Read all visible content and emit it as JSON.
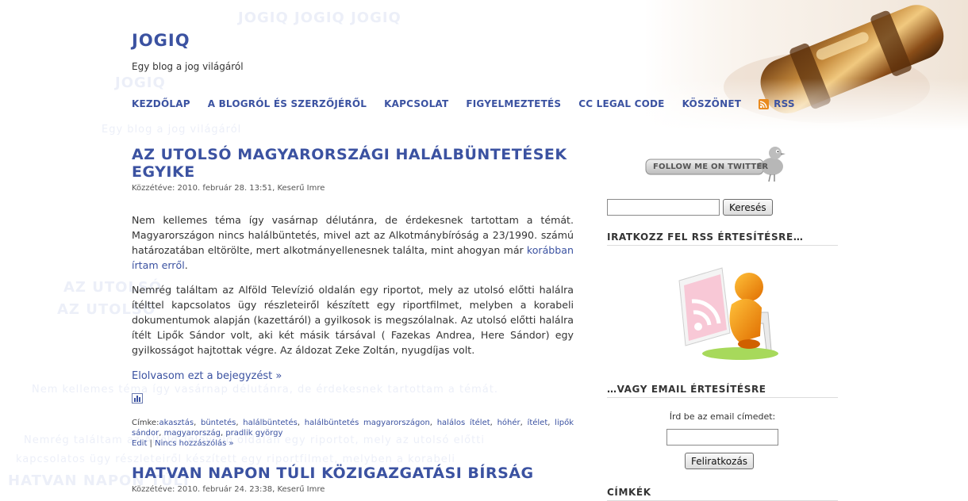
{
  "site": {
    "title": "JOGIQ",
    "tagline": "Egy blog a jog világáról"
  },
  "nav": {
    "items": [
      "KEZDŐLAP",
      "A BLOGRÓL ÉS SZERZŐJÉRŐL",
      "KAPCSOLAT",
      "FIGYELMEZTETÉS",
      "CC LEGAL CODE",
      "KÖSZÖNET"
    ],
    "rss_label": "RSS"
  },
  "posts": [
    {
      "title": "AZ UTOLSÓ MAGYARORSZÁGI HALÁLBÜNTETÉSEK EGYIKE",
      "meta": "Közzétéve: 2010. február 28. 13:51, Keserű Imre",
      "p1_text": "Nem kellemes téma így vasárnap délutánra, de érdekesnek tartottam a témát. Magyarországon nincs halálbüntetés, mivel azt az Alkotmánybíróság a 23/1990. számú határozatában eltörölte, mert alkotmányellenesnek találta, mint ahogyan már",
      "p1_link": "korábban írtam erről",
      "p1_end": ".",
      "p2": "Nemrég találtam az Alföld Televízió oldalán egy riportot, mely az utolsó előtti halálra ítélttel kapcsolatos ügy részleteiről készített egy riportfilmet, melyben a korabeli dokumentumok alapján (kazettáról) a gyilkosok is megszólalnak. Az utolsó előtti halálra ítélt Lipők Sándor volt, aki két másik társával ( Fazekas Andrea, Here Sándor) egy gyilkosságot hajtottak végre. Az áldozat Zeke Zoltán, nyugdíjas volt.",
      "read_more": "Elolvasom ezt a bejegyzést »",
      "tags_label": "Címke:",
      "tags": [
        "akasztás",
        "büntetés",
        "halálbüntetés",
        "halálbüntetés magyarországon",
        "halálos ítélet",
        "hóhér",
        "ítélet",
        "lipők sándor",
        "magyarország",
        "pradlik györgy"
      ],
      "edit_label": "Edit",
      "separator": " | ",
      "comments": "Nincs hozzászólás »"
    },
    {
      "title": "HATVAN NAPON TÚLI KÖZIGAZGATÁSI BÍRSÁG",
      "meta": "Közzétéve: 2010. február 24. 23:38, Keserű Imre"
    }
  ],
  "sidebar": {
    "twitter_label": "FOLLOW ME ON TWITTER",
    "search_button": "Keresés",
    "search_value": "",
    "rss_widget_title": "IRATKOZZ FEL RSS ÉRTESÍTÉSRE…",
    "email_widget_title": "…VAGY EMAIL ÉRTESÍTÉSRE",
    "email_label": "Írd be az email címedet:",
    "subscribe_button": "Feliratkozás",
    "tags_widget_title": "CÍMKÉK"
  },
  "colors": {
    "link": "#3b52a1",
    "rss_orange": "#e98a1e"
  }
}
